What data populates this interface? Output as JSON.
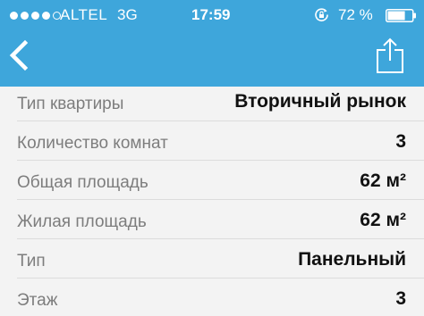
{
  "status_bar": {
    "signal_dots": [
      true,
      true,
      true,
      true,
      false
    ],
    "carrier": "ALTEL",
    "network": "3G",
    "time": "17:59",
    "battery_percent": "72 %",
    "battery_level": 0.72,
    "icons": [
      "rotation-lock-icon",
      "battery-icon"
    ]
  },
  "nav": {
    "background_color": "#3ea6db",
    "icons": [
      "chevron-left-icon",
      "share-icon"
    ]
  },
  "details": {
    "rows": [
      {
        "label": "Тип квартиры",
        "value": "Вторичный рынок"
      },
      {
        "label": "Количество комнат",
        "value": "3"
      },
      {
        "label": "Общая площадь",
        "value": "62 м²"
      },
      {
        "label": "Жилая площадь",
        "value": "62 м²"
      },
      {
        "label": "Тип",
        "value": "Панельный"
      },
      {
        "label": "Этаж",
        "value": "3"
      }
    ]
  }
}
